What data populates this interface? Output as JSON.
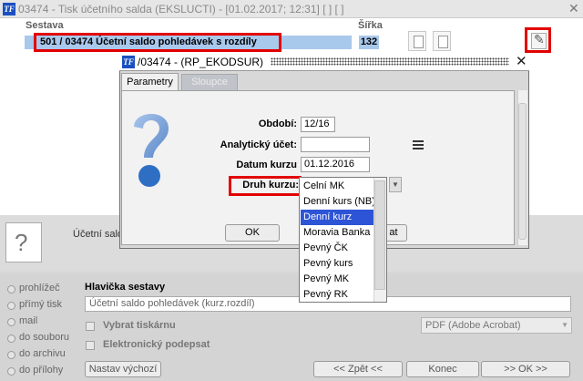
{
  "window": {
    "app_icon": "TF",
    "title": "03474 - Tisk účetního salda (EKSLUCTI) - [01.02.2017; 12:31] [ ] [ ]",
    "close": "✕"
  },
  "report_table": {
    "col_report": "Sestava",
    "col_width": "Šířka",
    "selected_row": {
      "text": "501 / 03474   Účetní saldo pohledávek s rozdíly",
      "width": "132"
    }
  },
  "dialog": {
    "icon": "TF",
    "title": "/03474 - (RP_EKODSUR)",
    "close": "✕",
    "tabs": [
      {
        "label": "Parametry",
        "active": true
      },
      {
        "label": "Sloupce",
        "active": false
      }
    ],
    "fields": {
      "period_label": "Období:",
      "period_value": "12/16",
      "analytic_label": "Analytický účet:",
      "analytic_value": "",
      "rate_date_label": "Datum kurzu",
      "rate_date_value": "01.12.2016",
      "rate_type_label": "Druh kurzu:"
    },
    "ok_label": "OK",
    "cancel_fragment": "at",
    "rate_type_options": [
      "Celní MK",
      "Denní kurs (NB)",
      "Denní kurz",
      "Moravia Banka",
      "Pevný ČK",
      "Pevný kurs",
      "Pevný MK",
      "Pevný RK"
    ],
    "rate_type_selected": "Denní kurz"
  },
  "printer": {
    "text": "Účetní sald",
    "text2": "at"
  },
  "output": {
    "options": [
      "prohlížeč",
      "přímý tisk",
      "mail",
      "do souboru",
      "do archivu",
      "do přílohy"
    ],
    "header_label": "Hlavička sestavy",
    "header_value": "Účetní saldo pohledávek (kurz.rozdíl)",
    "choose_printer": "Vybrat tiskárnu",
    "e_signature": "Elektronický podepsat",
    "printer_select": "PDF (Adobe Acrobat)",
    "reset_button": "Nastav výchozí",
    "back_button": "<< Zpět <<",
    "end_button": "Konec",
    "ok_button": ">> OK >>"
  },
  "colors": {
    "selection": "#a8c8ec",
    "highlight": "#e30000",
    "list_selected": "#2d54d6"
  }
}
